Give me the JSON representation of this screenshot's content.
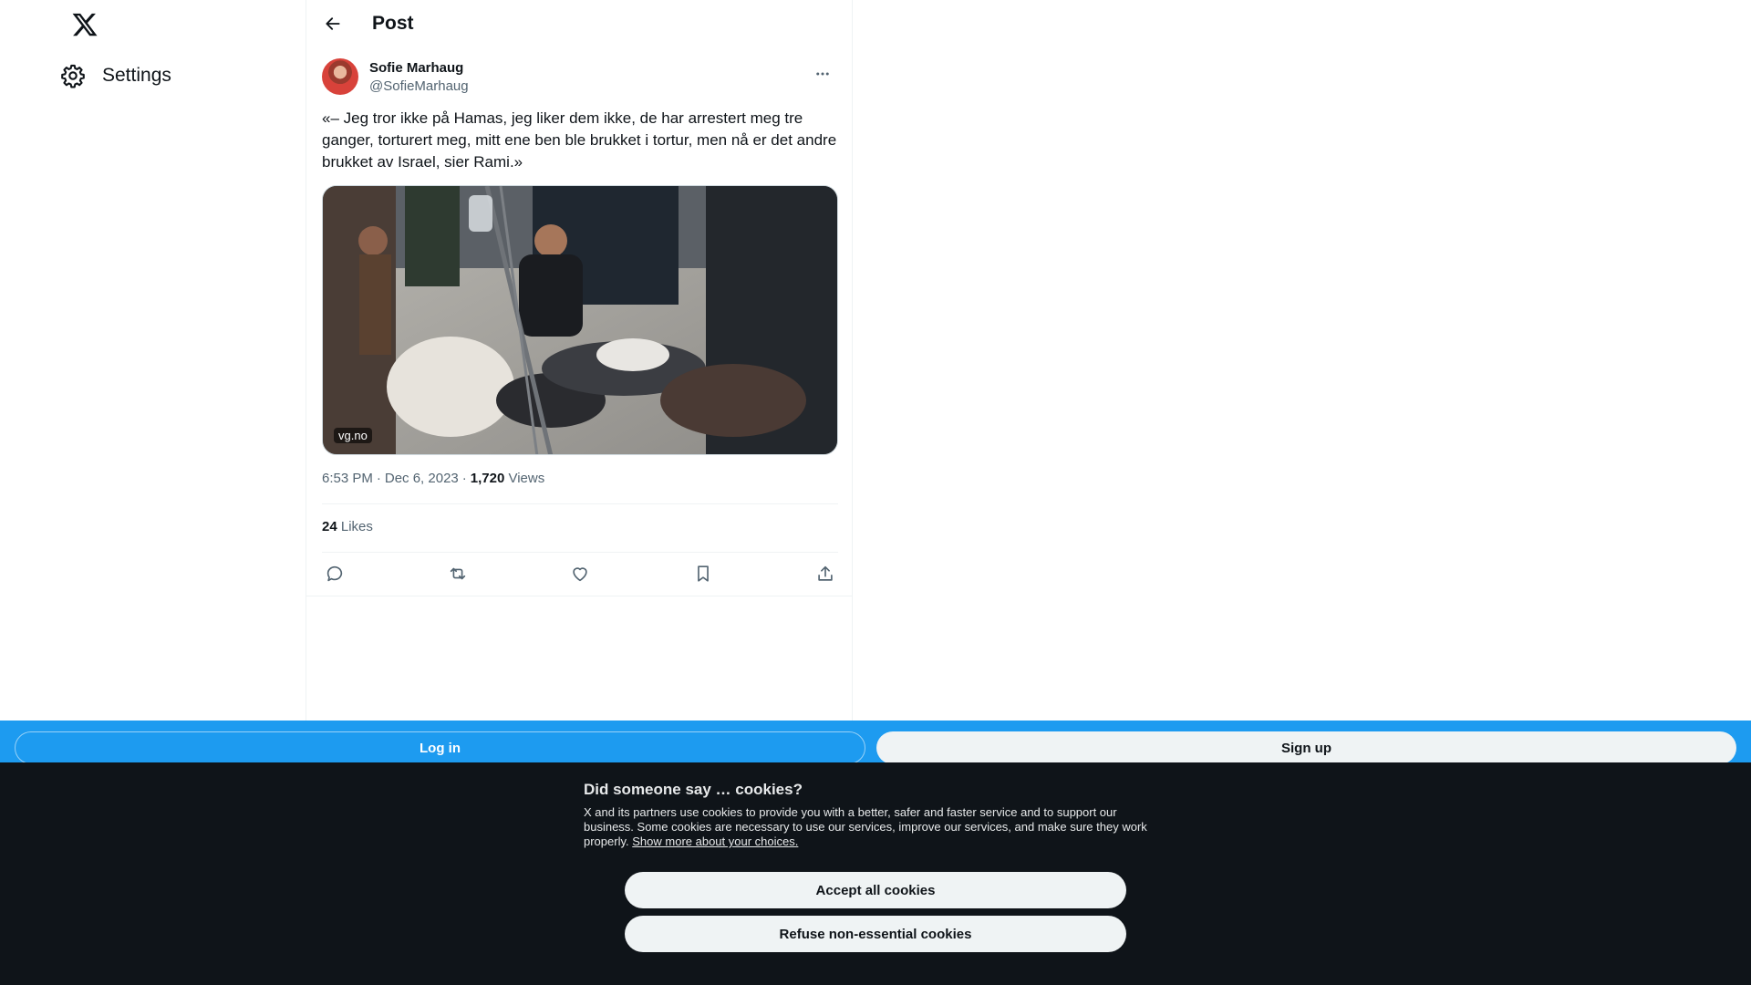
{
  "nav": {
    "logo_icon": "x-logo-icon",
    "settings_label": "Settings",
    "settings_icon": "gear-icon"
  },
  "header": {
    "back_icon": "arrow-left-icon",
    "title": "Post"
  },
  "post": {
    "author_name": "Sofie Marhaug",
    "author_handle": "@SofieMarhaug",
    "more_icon": "more-horizontal-icon",
    "text": "«– Jeg tror ikke på Hamas, jeg liker dem ikke, de har arrestert meg tre ganger, torturert meg, mitt ene ben ble brukket i tortur, men nå er det andre brukket av Israel, sier Rami.»",
    "media_domain": "vg.no",
    "time": "6:53 PM",
    "date": "Dec 6, 2023",
    "views_count": "1,720",
    "views_label": "Views",
    "likes_count": "24",
    "likes_label": "Likes",
    "actions": [
      "reply-icon",
      "repost-icon",
      "like-icon",
      "bookmark-icon",
      "share-icon"
    ]
  },
  "loginbar": {
    "login_label": "Log in",
    "signup_label": "Sign up"
  },
  "cookie": {
    "title": "Did someone say … cookies?",
    "body": "X and its partners use cookies to provide you with a better, safer and faster service and to support our business. Some cookies are necessary to use our services, improve our services, and make sure they work properly.",
    "link": "Show more about your choices.",
    "accept_label": "Accept all cookies",
    "refuse_label": "Refuse non-essential cookies"
  },
  "colors": {
    "accent": "#1d9bf0",
    "banner_bg": "#0f1419",
    "text_primary": "#0f1419",
    "text_secondary": "#536471"
  }
}
